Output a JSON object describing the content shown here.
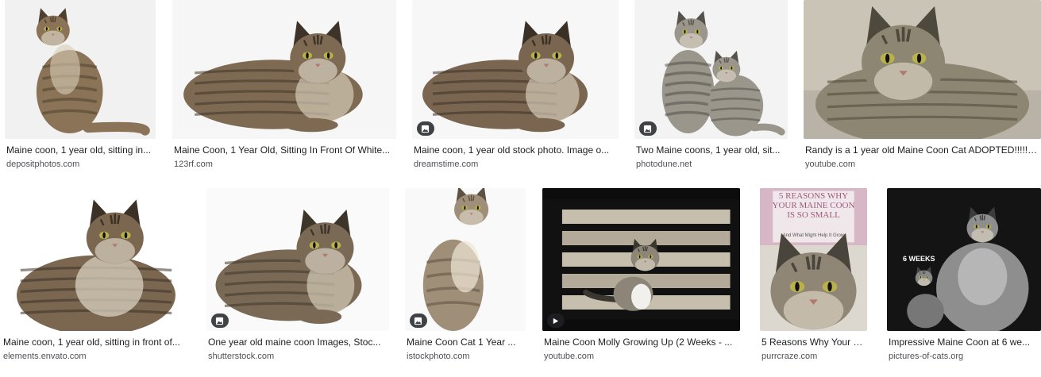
{
  "results": [
    {
      "caption": "Maine coon, 1 year old, sitting in...",
      "source": "depositphotos.com",
      "badge": "none",
      "bg": "#f1f1f1",
      "fur": "#8a7356",
      "dark": "#4e4030",
      "pose": "sit-side"
    },
    {
      "caption": "Maine Coon, 1 Year Old, Sitting In Front Of White...",
      "source": "123rf.com",
      "badge": "none",
      "bg": "#f6f6f6",
      "fur": "#7e6a52",
      "dark": "#3e3328",
      "pose": "lying"
    },
    {
      "caption": "Maine coon, 1 year old stock photo. Image o...",
      "source": "dreamstime.com",
      "badge": "image",
      "bg": "#f7f7f7",
      "fur": "#7a6650",
      "dark": "#3a3026",
      "pose": "lying"
    },
    {
      "caption": "Two Maine coons, 1 year old, sit...",
      "source": "photodune.net",
      "badge": "image",
      "bg": "#f3f3f3",
      "fur": "#9a968c",
      "dark": "#55524b",
      "pose": "two"
    },
    {
      "caption": "Randy is a 1 year old Maine Coon Cat ADOPTED!!!!!!...",
      "source": "youtube.com",
      "badge": "none",
      "bg": "#c9c4b6",
      "fur": "#8c8672",
      "dark": "#4d493c",
      "pose": "face"
    },
    {
      "caption": "Maine coon, 1 year old, sitting in front of...",
      "source": "elements.envato.com",
      "badge": "none",
      "bg": "#ffffff",
      "fur": "#7b6650",
      "dark": "#3b3127",
      "pose": "sit-front"
    },
    {
      "caption": "One year old maine coon Images, Stoc...",
      "source": "shutterstock.com",
      "badge": "image",
      "bg": "#fafafa",
      "fur": "#7a6a55",
      "dark": "#3e352a",
      "pose": "lying"
    },
    {
      "caption": "Maine Coon Cat 1 Year ...",
      "source": "istockphoto.com",
      "badge": "image",
      "bg": "#f9f9f9",
      "fur": "#a08f78",
      "dark": "#5e5242",
      "pose": "sit-tall"
    },
    {
      "caption": "Maine Coon Molly Growing Up (2 Weeks - ...",
      "source": "youtube.com",
      "badge": "video",
      "bg": "#111111",
      "fur": "#8d8678",
      "dark": "#3a3630",
      "pose": "kitten"
    },
    {
      "caption": "5 Reasons Why Your M...",
      "source": "purrcraze.com",
      "badge": "none",
      "bg": "#dcd7cf",
      "fur": "#8f8676",
      "dark": "#4a453c",
      "pose": "poster",
      "poster_text": "5 REASONS WHY YOUR MAINE COON IS SO SMALL",
      "poster_sub": "And What Might Help It Grow"
    },
    {
      "caption": "Impressive Maine Coon at 6 we...",
      "source": "pictures-of-cats.org",
      "badge": "none",
      "bg": "#141414",
      "fur": "#8e8e8e",
      "dark": "#3c3c3c",
      "pose": "dark",
      "overlay_text": "6 WEEKS"
    }
  ]
}
